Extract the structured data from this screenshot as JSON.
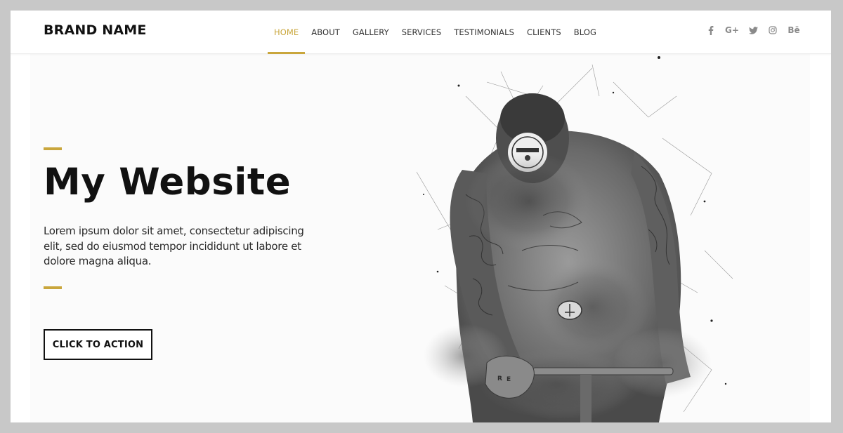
{
  "brand": {
    "name": "BRAND NAME"
  },
  "nav": {
    "items": [
      {
        "label": "HOME",
        "active": true
      },
      {
        "label": "ABOUT"
      },
      {
        "label": "GALLERY"
      },
      {
        "label": "SERVICES"
      },
      {
        "label": "TESTIMONIALS"
      },
      {
        "label": "CLIENTS"
      },
      {
        "label": "BLOG"
      }
    ]
  },
  "social": {
    "icons": [
      "facebook-icon",
      "google-plus-icon",
      "twitter-icon",
      "instagram-icon",
      "behance-icon"
    ],
    "google_plus_text": "G+",
    "behance_text": "Bē"
  },
  "hero": {
    "title": "My Website",
    "text": "Lorem ipsum dolor sit amet, consectetur adipiscing elit, sed do eiusmod tempor incididunt ut labore et dolore magna aliqua.",
    "cta_label": "CLICK TO ACTION",
    "image_description_icon": "tattooed-cyclist-sketch-image"
  },
  "colors": {
    "accent": "#c9a63c",
    "text": "#111111",
    "background": "#ffffff",
    "outer_frame": "#c8c8c8"
  }
}
